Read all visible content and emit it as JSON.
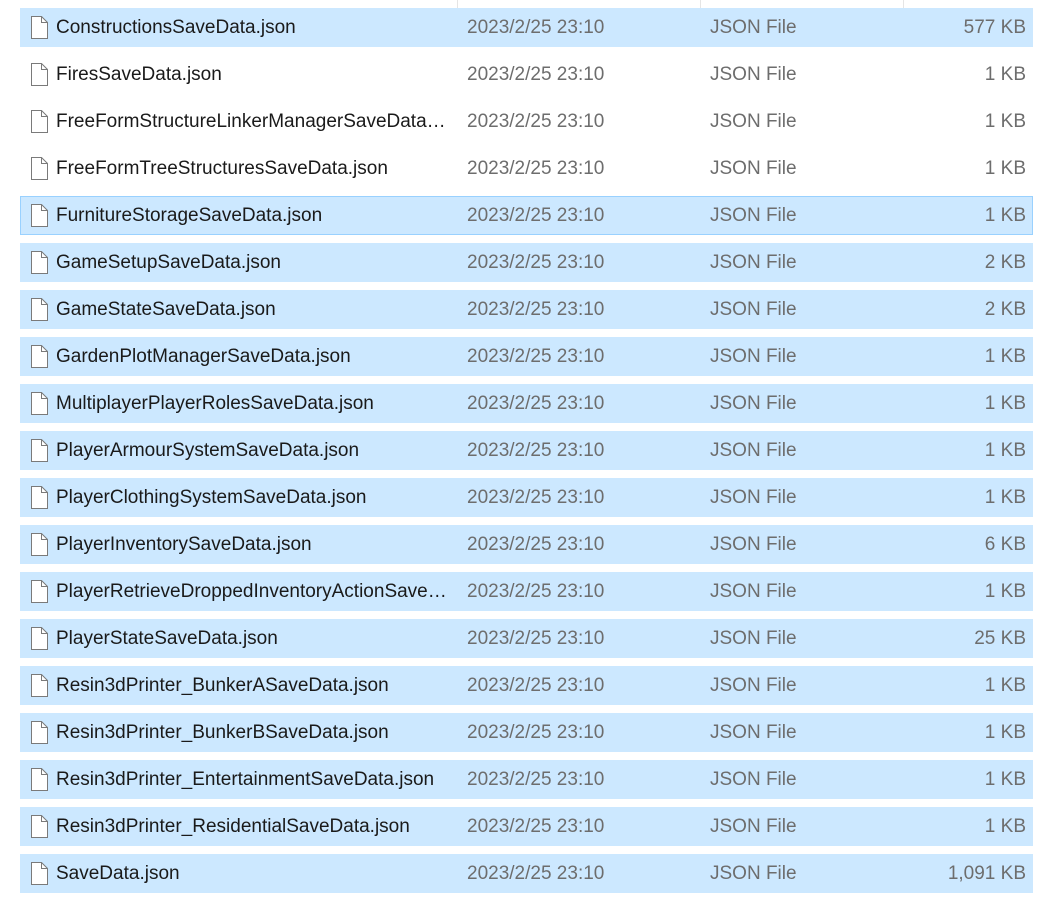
{
  "files": [
    {
      "name": "ConstructionsSaveData.json",
      "date": "2023/2/25 23:10",
      "type": "JSON File",
      "size": "577 KB",
      "selected": true,
      "icon": "file-icon"
    },
    {
      "name": "FiresSaveData.json",
      "date": "2023/2/25 23:10",
      "type": "JSON File",
      "size": "1 KB",
      "selected": false,
      "icon": "file-icon"
    },
    {
      "name": "FreeFormStructureLinkerManagerSaveData.json",
      "date": "2023/2/25 23:10",
      "type": "JSON File",
      "size": "1 KB",
      "selected": false,
      "icon": "file-icon"
    },
    {
      "name": "FreeFormTreeStructuresSaveData.json",
      "date": "2023/2/25 23:10",
      "type": "JSON File",
      "size": "1 KB",
      "selected": false,
      "icon": "file-icon"
    },
    {
      "name": "FurnitureStorageSaveData.json",
      "date": "2023/2/25 23:10",
      "type": "JSON File",
      "size": "1 KB",
      "selected": true,
      "focused": true,
      "icon": "file-icon"
    },
    {
      "name": "GameSetupSaveData.json",
      "date": "2023/2/25 23:10",
      "type": "JSON File",
      "size": "2 KB",
      "selected": true,
      "icon": "file-icon"
    },
    {
      "name": "GameStateSaveData.json",
      "date": "2023/2/25 23:10",
      "type": "JSON File",
      "size": "2 KB",
      "selected": true,
      "icon": "file-icon"
    },
    {
      "name": "GardenPlotManagerSaveData.json",
      "date": "2023/2/25 23:10",
      "type": "JSON File",
      "size": "1 KB",
      "selected": true,
      "icon": "file-icon"
    },
    {
      "name": "MultiplayerPlayerRolesSaveData.json",
      "date": "2023/2/25 23:10",
      "type": "JSON File",
      "size": "1 KB",
      "selected": true,
      "icon": "file-icon"
    },
    {
      "name": "PlayerArmourSystemSaveData.json",
      "date": "2023/2/25 23:10",
      "type": "JSON File",
      "size": "1 KB",
      "selected": true,
      "icon": "file-icon"
    },
    {
      "name": "PlayerClothingSystemSaveData.json",
      "date": "2023/2/25 23:10",
      "type": "JSON File",
      "size": "1 KB",
      "selected": true,
      "icon": "file-icon"
    },
    {
      "name": "PlayerInventorySaveData.json",
      "date": "2023/2/25 23:10",
      "type": "JSON File",
      "size": "6 KB",
      "selected": true,
      "icon": "file-icon"
    },
    {
      "name": "PlayerRetrieveDroppedInventoryActionSaveData.json",
      "date": "2023/2/25 23:10",
      "type": "JSON File",
      "size": "1 KB",
      "selected": true,
      "icon": "file-icon"
    },
    {
      "name": "PlayerStateSaveData.json",
      "date": "2023/2/25 23:10",
      "type": "JSON File",
      "size": "25 KB",
      "selected": true,
      "icon": "file-icon"
    },
    {
      "name": "Resin3dPrinter_BunkerASaveData.json",
      "date": "2023/2/25 23:10",
      "type": "JSON File",
      "size": "1 KB",
      "selected": true,
      "icon": "file-icon"
    },
    {
      "name": "Resin3dPrinter_BunkerBSaveData.json",
      "date": "2023/2/25 23:10",
      "type": "JSON File",
      "size": "1 KB",
      "selected": true,
      "icon": "file-icon"
    },
    {
      "name": "Resin3dPrinter_EntertainmentSaveData.json",
      "date": "2023/2/25 23:10",
      "type": "JSON File",
      "size": "1 KB",
      "selected": true,
      "icon": "file-icon"
    },
    {
      "name": "Resin3dPrinter_ResidentialSaveData.json",
      "date": "2023/2/25 23:10",
      "type": "JSON File",
      "size": "1 KB",
      "selected": true,
      "icon": "file-icon"
    },
    {
      "name": "SaveData.json",
      "date": "2023/2/25 23:10",
      "type": "JSON File",
      "size": "1,091 KB",
      "selected": true,
      "icon": "file-icon"
    }
  ],
  "colors": {
    "selection": "#cce8ff",
    "focus_border": "#99d1ff",
    "name_text": "#1a1a1a",
    "meta_text": "#6d6d6d"
  }
}
